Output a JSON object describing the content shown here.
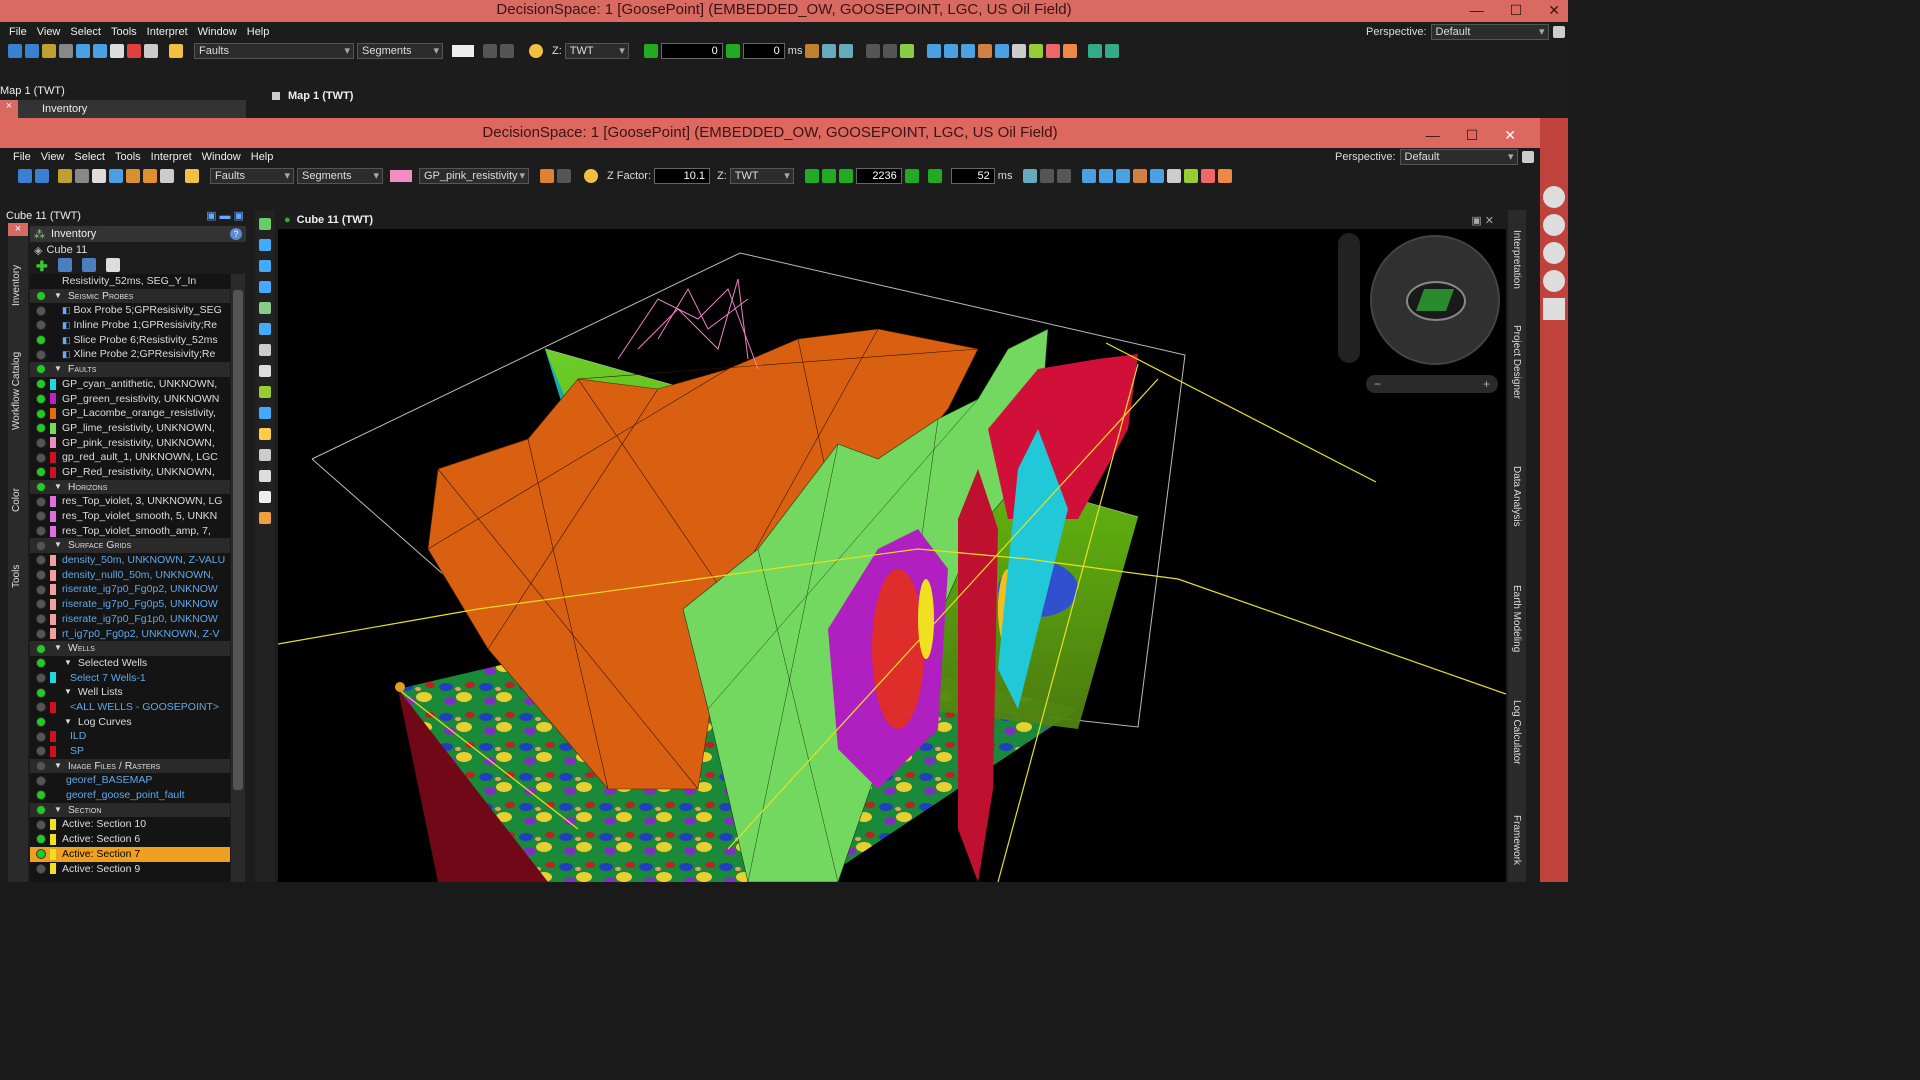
{
  "back_window": {
    "title": "DecisionSpace: 1 [GoosePoint] (EMBEDDED_OW, GOOSEPOINT, LGC, US Oil Field)",
    "menu": [
      "File",
      "View",
      "Select",
      "Tools",
      "Interpret",
      "Window",
      "Help"
    ],
    "perspective_label": "Perspective:",
    "perspective_value": "Default",
    "faults_combo": "Faults",
    "segments_combo": "Segments",
    "z_label": "Z:",
    "z_value": "TWT",
    "field1": "0",
    "field2": "0",
    "ms_label": "ms",
    "panel_title": "Map 1 (TWT)",
    "inventory_label": "Inventory",
    "map_tab": "Map 1 (TWT)"
  },
  "front_window": {
    "title": "DecisionSpace: 1 [GoosePoint] (EMBEDDED_OW, GOOSEPOINT, LGC, US Oil Field)",
    "menu": [
      "File",
      "View",
      "Select",
      "Tools",
      "Interpret",
      "Window",
      "Help"
    ],
    "perspective_label": "Perspective:",
    "perspective_value": "Default",
    "faults_combo": "Faults",
    "segments_combo": "Segments",
    "color_combo": "GP_pink_resistivity",
    "color_swatch": "#f08cc0",
    "zfactor_label": "Z Factor:",
    "zfactor_value": "10.1",
    "z_label": "Z:",
    "z_value": "TWT",
    "slice_value": "2236",
    "ms_value": "52",
    "ms_label": "ms"
  },
  "left_panel": {
    "title": "Cube 11 (TWT)",
    "inventory_label": "Inventory",
    "root": "Cube 11",
    "side_tabs": [
      "Inventory",
      "Workflow Catalog",
      "Color",
      "Tools"
    ]
  },
  "inventory": [
    {
      "type": "item",
      "text": "Resistivity_52ms, SEG_Y_In",
      "dot": "none",
      "color": ""
    },
    {
      "type": "section",
      "text": "Seismic Probes",
      "dot": "g"
    },
    {
      "type": "item",
      "text": "Box Probe 5;GPResisivity_SEG",
      "dot": "",
      "color": "",
      "icon": true
    },
    {
      "type": "item",
      "text": "Inline Probe 1;GPResisivity;Re",
      "dot": "",
      "color": "",
      "icon": true
    },
    {
      "type": "item",
      "text": "Slice Probe 6;Resistivity_52ms",
      "dot": "g",
      "color": "",
      "icon": true
    },
    {
      "type": "item",
      "text": "Xline Probe 2;GPResisivity;Re",
      "dot": "",
      "color": "",
      "icon": true
    },
    {
      "type": "section",
      "text": "Faults",
      "dot": "g"
    },
    {
      "type": "item",
      "text": "GP_cyan_antithetic, UNKNOWN,",
      "dot": "g",
      "color": "#22d8e0"
    },
    {
      "type": "item",
      "text": "GP_green_resistivity, UNKNOWN",
      "dot": "g",
      "color": "#c020c0"
    },
    {
      "type": "item",
      "text": "GP_Lacombe_orange_resistivity,",
      "dot": "g",
      "color": "#e86a10"
    },
    {
      "type": "item",
      "text": "GP_lime_resistivity, UNKNOWN,",
      "dot": "g",
      "color": "#70e050"
    },
    {
      "type": "item",
      "text": "GP_pink_resistivity, UNKNOWN,",
      "dot": "",
      "color": "#f08cc0"
    },
    {
      "type": "item",
      "text": "gp_red_ault_1, UNKNOWN, LGC",
      "dot": "",
      "color": "#d01020"
    },
    {
      "type": "item",
      "text": "GP_Red_resistivity, UNKNOWN,",
      "dot": "g",
      "color": "#d01020"
    },
    {
      "type": "section",
      "text": "Horizons",
      "dot": "g"
    },
    {
      "type": "item",
      "text": "res_Top_violet, 3, UNKNOWN, LG",
      "dot": "",
      "color": "#e070e0"
    },
    {
      "type": "item",
      "text": "res_Top_violet_smooth, 5, UNKN",
      "dot": "",
      "color": "#e070e0"
    },
    {
      "type": "item",
      "text": "res_Top_violet_smooth_amp, 7,",
      "dot": "",
      "color": "#e070e0"
    },
    {
      "type": "section",
      "text": "Surface Grids",
      "dot": ""
    },
    {
      "type": "link",
      "text": "density_50m, UNKNOWN, Z-VALU",
      "dot": "",
      "color": "#f0a0a0"
    },
    {
      "type": "link",
      "text": "density_null0_50m, UNKNOWN,",
      "dot": "",
      "color": "#f0a0a0"
    },
    {
      "type": "link",
      "text": "riserate_ig7p0_Fg0p2, UNKNOW",
      "dot": "",
      "color": "#f0a0a0"
    },
    {
      "type": "link",
      "text": "riserate_ig7p0_Fg0p5, UNKNOW",
      "dot": "",
      "color": "#f0a0a0"
    },
    {
      "type": "link",
      "text": "riserate_ig7p0_Fg1p0, UNKNOW",
      "dot": "",
      "color": "#f0a0a0"
    },
    {
      "type": "link",
      "text": "rt_ig7p0_Fg0p2, UNKNOWN, Z-V",
      "dot": "",
      "color": "#f0a0a0"
    },
    {
      "type": "section",
      "text": "Wells",
      "dot": "g"
    },
    {
      "type": "sub",
      "text": "Selected Wells",
      "dot": "g"
    },
    {
      "type": "link",
      "text": "Select 7 Wells-1",
      "dot": "",
      "color": "#22d8e0",
      "indent": true
    },
    {
      "type": "sub",
      "text": "Well Lists",
      "dot": "g"
    },
    {
      "type": "link",
      "text": "<ALL WELLS - GOOSEPOINT>",
      "dot": "",
      "color": "#d01020",
      "indent": true
    },
    {
      "type": "sub",
      "text": "Log Curves",
      "dot": "g"
    },
    {
      "type": "link",
      "text": "ILD",
      "dot": "",
      "color": "#d01020",
      "indent": true
    },
    {
      "type": "link",
      "text": "SP",
      "dot": "",
      "color": "#d01020",
      "indent": true
    },
    {
      "type": "section",
      "text": "Image Files / Rasters",
      "dot": ""
    },
    {
      "type": "link",
      "text": "georef_BASEMAP",
      "dot": "",
      "color": ""
    },
    {
      "type": "link",
      "text": "georef_goose_point_fault",
      "dot": "g",
      "color": ""
    },
    {
      "type": "section",
      "text": "Section",
      "dot": "g"
    },
    {
      "type": "item",
      "text": "Active: Section 10",
      "dot": "",
      "color": "#f0e020"
    },
    {
      "type": "item",
      "text": "Active: Section 6",
      "dot": "g",
      "color": "#f0e020"
    },
    {
      "type": "item",
      "text": "Active: Section 7",
      "dot": "g",
      "color": "#f0e020",
      "selected": true
    },
    {
      "type": "item",
      "text": "Active: Section 9",
      "dot": "",
      "color": "#f0e020"
    }
  ],
  "viewport": {
    "tab_title": "Cube 11 (TWT)"
  },
  "right_tabs": [
    "Interpretation",
    "Project Designer",
    "Data Analysis",
    "Earth Modeling",
    "Log Calculator",
    "Framework"
  ]
}
